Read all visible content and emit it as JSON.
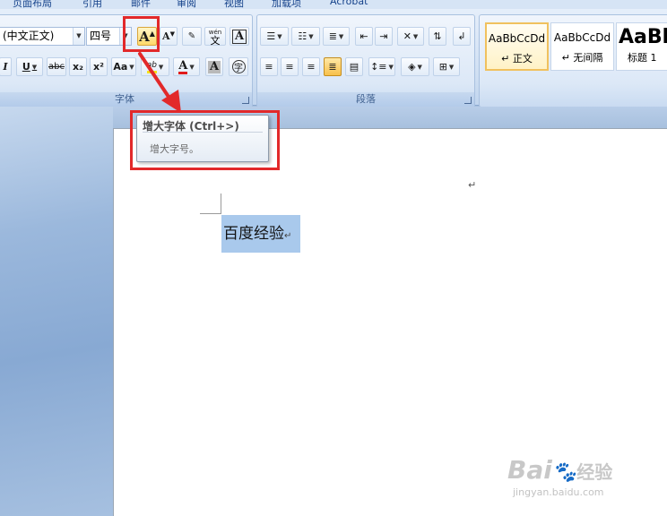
{
  "ribbon_tabs": [
    "页面布局",
    "引用",
    "邮件",
    "审阅",
    "视图",
    "加载项",
    "Acrobat"
  ],
  "font_group": {
    "label": "字体",
    "font_name": "(中文正文)",
    "font_size": "四号",
    "grow_font_glyph": "A",
    "shrink_font_glyph": "A",
    "phonetic_guide": "wén",
    "phonetic_char": "文",
    "char_border_glyph": "A",
    "italic": "I",
    "underline": "U",
    "strikethrough": "abc",
    "subscript": "x₂",
    "superscript": "x²",
    "change_case": "Aa",
    "highlight_glyph": "ab",
    "font_color_glyph": "A",
    "char_shading_glyph": "A",
    "enclose_char": "字",
    "highlight_color": "#f5e31a",
    "font_color": "#e01b1b"
  },
  "paragraph_group": {
    "label": "段落"
  },
  "styles_group": {
    "styles": [
      {
        "preview": "AaBbCcDd",
        "name": "↵ 正文",
        "selected": true
      },
      {
        "preview": "AaBbCcDd",
        "name": "↵ 无间隔",
        "selected": false
      },
      {
        "preview": "AaBb",
        "name": "标题 1",
        "selected": false
      }
    ]
  },
  "tooltip": {
    "title": "增大字体 (Ctrl+>)",
    "description": "增大字号。"
  },
  "document": {
    "selected_text": "百度经验",
    "paragraph_mark": "↵"
  },
  "watermark": {
    "brand": "Bai",
    "brand_suffix": "经验",
    "url": "jingyan.baidu.com"
  },
  "colors": {
    "annotation_red": "#e2292a",
    "selection_blue": "#a9c9ec",
    "ribbon_blue": "#dce8f7",
    "workspace_blue": "#a7c0de"
  }
}
